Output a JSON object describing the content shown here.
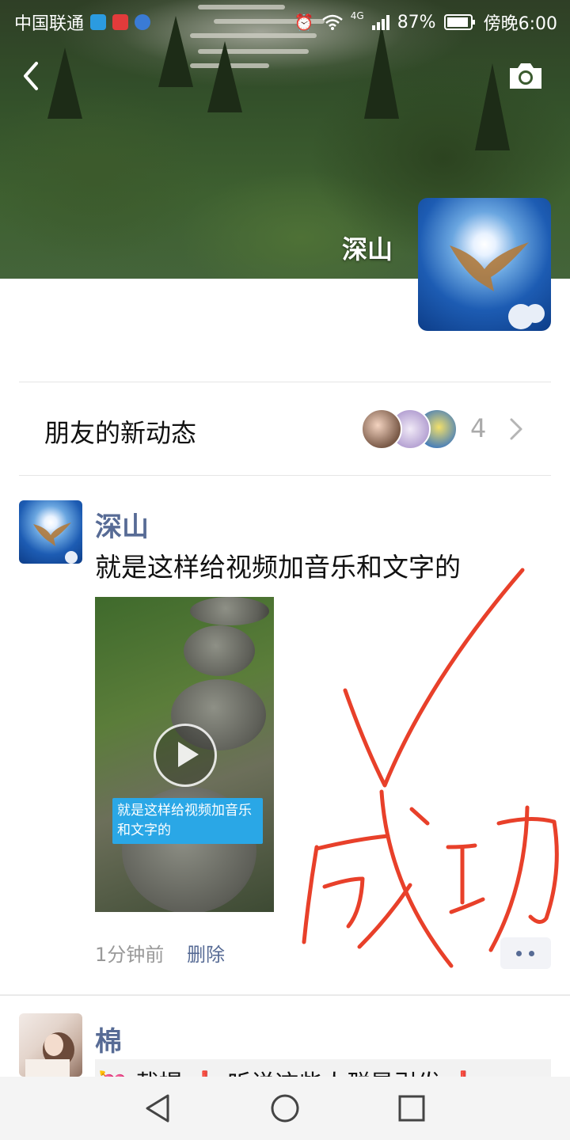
{
  "status_bar": {
    "carrier": "中国联通",
    "network": "4G",
    "battery": "87%",
    "time": "傍晚6:00"
  },
  "cover": {
    "name": "深山"
  },
  "friends_updates": {
    "label": "朋友的新动态",
    "count": "4"
  },
  "post": {
    "author": "深山",
    "text": "就是这样给视频加音乐和文字的",
    "video_caption": "就是这样给视频加音乐和文字的",
    "time": "1分钟前",
    "delete_label": "删除"
  },
  "annotation": {
    "text": "成功",
    "color": "#e8402a"
  },
  "post2": {
    "author": "棉",
    "preview": "💘 截提 ❗ 听说这些人群是引发 ❗"
  },
  "nav": {
    "back": "back-triangle-icon",
    "home": "home-circle-icon",
    "recents": "recents-square-icon"
  },
  "colors": {
    "link_blue": "#576b95",
    "accent_red": "#e8402a"
  }
}
